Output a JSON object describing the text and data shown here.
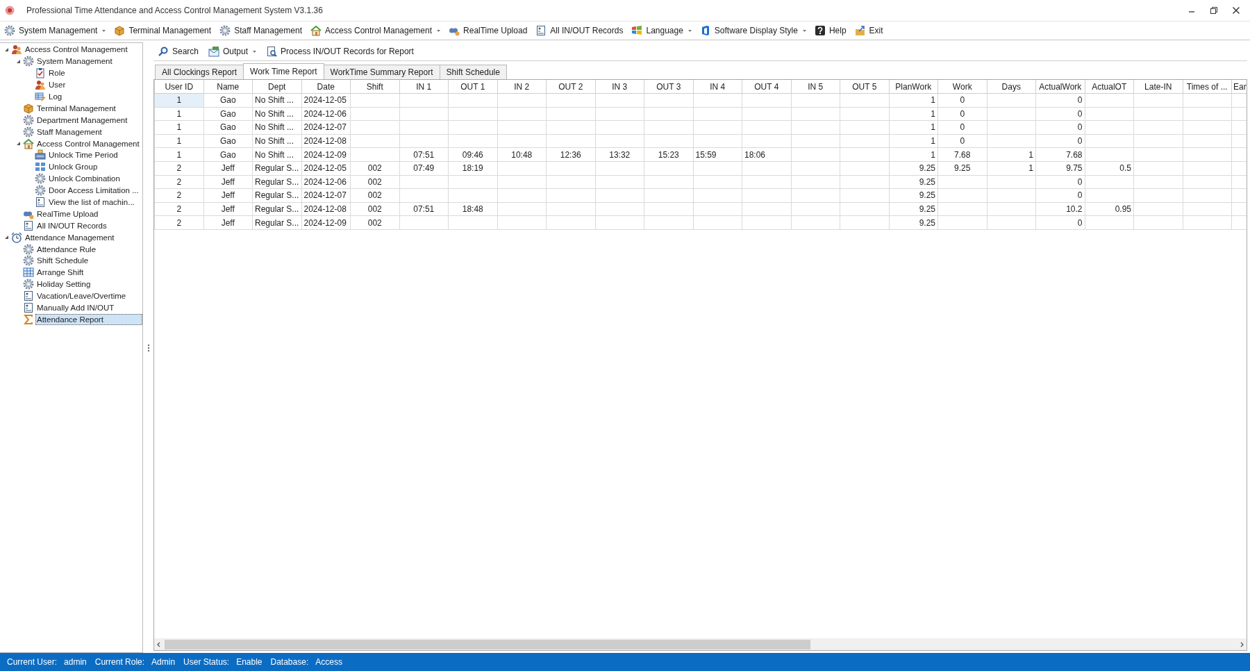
{
  "window": {
    "title": "Professional Time Attendance and Access Control Management System V3.1.36"
  },
  "menu": [
    {
      "label": "System Management",
      "kind": "gear",
      "dropdown": true
    },
    {
      "label": "Terminal Management",
      "kind": "box",
      "dropdown": false
    },
    {
      "label": "Staff Management",
      "kind": "gear",
      "dropdown": false
    },
    {
      "label": "Access Control Management",
      "kind": "house",
      "dropdown": true
    },
    {
      "label": "RealTime Upload",
      "kind": "binoc",
      "dropdown": false
    },
    {
      "label": "All IN/OUT Records",
      "kind": "doc",
      "dropdown": false
    },
    {
      "label": "Language",
      "kind": "flag",
      "dropdown": true
    },
    {
      "label": "Software Display Style",
      "kind": "bracket",
      "dropdown": true
    },
    {
      "label": "Help",
      "kind": "help",
      "dropdown": false
    },
    {
      "label": "Exit",
      "kind": "exit",
      "dropdown": false
    }
  ],
  "tree": [
    {
      "label": "Access Control Management",
      "kind": "users",
      "expanded": true,
      "selected": false,
      "children": [
        {
          "label": "System Management",
          "kind": "gear",
          "expanded": true,
          "selected": false,
          "children": [
            {
              "label": "Role",
              "kind": "role",
              "selected": false
            },
            {
              "label": "User",
              "kind": "users",
              "selected": false
            },
            {
              "label": "Log",
              "kind": "log",
              "selected": false
            }
          ]
        },
        {
          "label": "Terminal Management",
          "kind": "box",
          "selected": false
        },
        {
          "label": "Department Management",
          "kind": "gear",
          "selected": false
        },
        {
          "label": "Staff Management",
          "kind": "gear",
          "selected": false
        },
        {
          "label": "Access Control Management",
          "kind": "house",
          "expanded": true,
          "selected": false,
          "children": [
            {
              "label": "Unlock Time Period",
              "kind": "device",
              "selected": false
            },
            {
              "label": "Unlock Group",
              "kind": "grid",
              "selected": false
            },
            {
              "label": "Unlock Combination",
              "kind": "gear",
              "selected": false
            },
            {
              "label": "Door Access Limitation ...",
              "kind": "gear",
              "selected": false
            },
            {
              "label": "View the list of machin...",
              "kind": "doc",
              "selected": false
            }
          ]
        },
        {
          "label": "RealTime Upload",
          "kind": "binoc",
          "selected": false
        },
        {
          "label": "All IN/OUT Records",
          "kind": "doc",
          "selected": false
        }
      ]
    },
    {
      "label": "Attendance Management",
      "kind": "clock",
      "expanded": true,
      "selected": false,
      "children": [
        {
          "label": "Attendance Rule",
          "kind": "gear",
          "selected": false
        },
        {
          "label": "Shift Schedule",
          "kind": "gear",
          "selected": false
        },
        {
          "label": "Arrange Shift",
          "kind": "table",
          "selected": false
        },
        {
          "label": "Holiday Setting",
          "kind": "gear",
          "selected": false
        },
        {
          "label": "Vacation/Leave/Overtime",
          "kind": "doc",
          "selected": false
        },
        {
          "label": "Manually Add IN/OUT",
          "kind": "doc",
          "selected": false
        },
        {
          "label": "Attendance Report",
          "kind": "sigma",
          "selected": true
        }
      ]
    }
  ],
  "toolbar": [
    {
      "label": "Search",
      "kind": "search",
      "dropdown": false
    },
    {
      "label": "Output",
      "kind": "sheet",
      "dropdown": true
    },
    {
      "label": "Process IN/OUT Records for Report",
      "kind": "docsearch",
      "dropdown": false
    }
  ],
  "tabs": [
    {
      "label": "All Clockings Report",
      "selected": false
    },
    {
      "label": "Work Time Report",
      "selected": true
    },
    {
      "label": "WorkTime Summary Report",
      "selected": false
    },
    {
      "label": "Shift Schedule",
      "selected": false
    }
  ],
  "table": {
    "columns": [
      "User ID",
      "Name",
      "Dept",
      "Date",
      "Shift",
      "IN 1",
      "OUT 1",
      "IN 2",
      "OUT 2",
      "IN 3",
      "OUT 3",
      "IN 4",
      "OUT 4",
      "IN 5",
      "OUT 5",
      "PlanWork",
      "Work",
      "Days",
      "ActualWork",
      "ActualOT",
      "Late-IN",
      "Times of ...",
      "Ear"
    ],
    "rows": [
      {
        "selected": true,
        "cells": [
          "1",
          "Gao",
          "No Shift ...",
          "2024-12-05",
          null,
          null,
          null,
          null,
          null,
          null,
          null,
          null,
          null,
          null,
          null,
          "1",
          "0",
          null,
          "0",
          null,
          null,
          null,
          null
        ]
      },
      {
        "selected": false,
        "cells": [
          "1",
          "Gao",
          "No Shift ...",
          "2024-12-06",
          null,
          null,
          null,
          null,
          null,
          null,
          null,
          null,
          null,
          null,
          null,
          "1",
          "0",
          null,
          "0",
          null,
          null,
          null,
          null
        ]
      },
      {
        "selected": false,
        "cells": [
          "1",
          "Gao",
          "No Shift ...",
          "2024-12-07",
          null,
          null,
          null,
          null,
          null,
          null,
          null,
          null,
          null,
          null,
          null,
          "1",
          "0",
          null,
          "0",
          null,
          null,
          null,
          null
        ]
      },
      {
        "selected": false,
        "cells": [
          "1",
          "Gao",
          "No Shift ...",
          "2024-12-08",
          null,
          null,
          null,
          null,
          null,
          null,
          null,
          null,
          null,
          null,
          null,
          "1",
          "0",
          null,
          "0",
          null,
          null,
          null,
          null
        ]
      },
      {
        "selected": false,
        "cells": [
          "1",
          "Gao",
          "No Shift ...",
          "2024-12-09",
          null,
          "07:51",
          "09:46",
          "10:48",
          "12:36",
          "13:32",
          "15:23",
          "15:59",
          "18:06",
          null,
          null,
          "1",
          "7.68",
          "1",
          "7.68",
          null,
          null,
          null,
          null
        ]
      },
      {
        "selected": false,
        "cells": [
          "2",
          "Jeff",
          "Regular S...",
          "2024-12-05",
          "002",
          "07:49",
          "18:19",
          null,
          null,
          null,
          null,
          null,
          null,
          null,
          null,
          "9.25",
          "9.25",
          "1",
          "9.75",
          "0.5",
          null,
          null,
          null
        ]
      },
      {
        "selected": false,
        "cells": [
          "2",
          "Jeff",
          "Regular S...",
          "2024-12-06",
          "002",
          null,
          null,
          null,
          null,
          null,
          null,
          null,
          null,
          null,
          null,
          "9.25",
          null,
          null,
          "0",
          null,
          null,
          null,
          null
        ]
      },
      {
        "selected": false,
        "cells": [
          "2",
          "Jeff",
          "Regular S...",
          "2024-12-07",
          "002",
          null,
          null,
          null,
          null,
          null,
          null,
          null,
          null,
          null,
          null,
          "9.25",
          null,
          null,
          "0",
          null,
          null,
          null,
          null
        ]
      },
      {
        "selected": false,
        "cells": [
          "2",
          "Jeff",
          "Regular S...",
          "2024-12-08",
          "002",
          "07:51",
          "18:48",
          null,
          null,
          null,
          null,
          null,
          null,
          null,
          null,
          "9.25",
          null,
          null,
          "10.2",
          "0.95",
          null,
          null,
          null
        ]
      },
      {
        "selected": false,
        "cells": [
          "2",
          "Jeff",
          "Regular S...",
          "2024-12-09",
          "002",
          null,
          null,
          null,
          null,
          null,
          null,
          null,
          null,
          null,
          null,
          "9.25",
          null,
          null,
          "0",
          null,
          null,
          null,
          null
        ]
      }
    ]
  },
  "status_bar": [
    {
      "label": "Current User:",
      "value": "admin"
    },
    {
      "label": "Current Role:",
      "value": "Admin"
    },
    {
      "label": "User Status:",
      "value": "Enable"
    },
    {
      "label": "Database:",
      "value": "Access"
    }
  ]
}
